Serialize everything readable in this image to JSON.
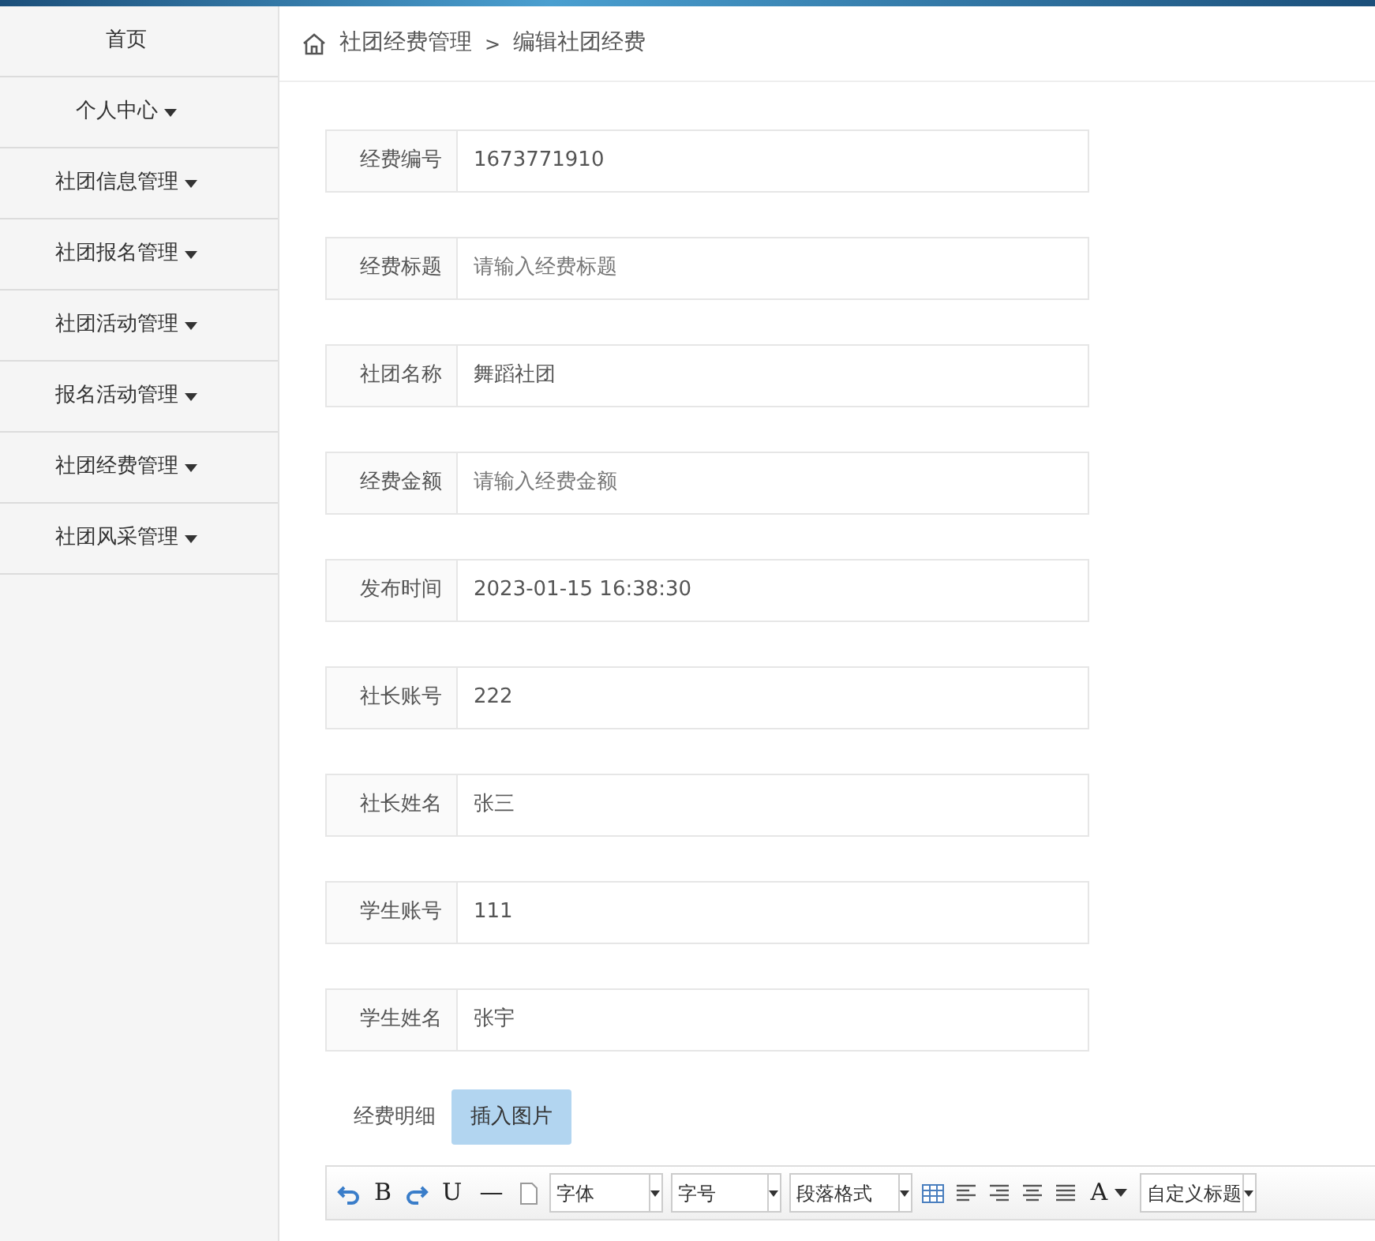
{
  "sidebar": {
    "items": [
      {
        "label": "首页",
        "dropdown": false
      },
      {
        "label": "个人中心",
        "dropdown": true
      },
      {
        "label": "社团信息管理",
        "dropdown": true
      },
      {
        "label": "社团报名管理",
        "dropdown": true
      },
      {
        "label": "社团活动管理",
        "dropdown": true
      },
      {
        "label": "报名活动管理",
        "dropdown": true
      },
      {
        "label": "社团经费管理",
        "dropdown": true
      },
      {
        "label": "社团风采管理",
        "dropdown": true
      }
    ]
  },
  "breadcrumb": {
    "items": [
      "社团经费管理",
      "编辑社团经费"
    ],
    "separator": ">"
  },
  "form": {
    "fields": [
      {
        "label": "经费编号",
        "value": "1673771910"
      },
      {
        "label": "经费标题",
        "placeholder": "请输入经费标题"
      },
      {
        "label": "社团名称",
        "value": "舞蹈社团"
      },
      {
        "label": "经费金额",
        "placeholder": "请输入经费金额"
      },
      {
        "label": "发布时间",
        "value": "2023-01-15 16:38:30"
      },
      {
        "label": "社长账号",
        "value": "222"
      },
      {
        "label": "社长姓名",
        "value": "张三"
      },
      {
        "label": "学生账号",
        "value": "111"
      },
      {
        "label": "学生姓名",
        "value": "张宇"
      }
    ],
    "detail_label": "经费明细",
    "insert_image_button": "插入图片"
  },
  "editor": {
    "toolbar": [
      {
        "kind": "undo"
      },
      {
        "kind": "glyph",
        "text": "B"
      },
      {
        "kind": "redo"
      },
      {
        "kind": "glyph",
        "text": "U"
      },
      {
        "kind": "glyph",
        "text": "—"
      },
      {
        "kind": "page"
      },
      {
        "kind": "select",
        "text": "字体"
      },
      {
        "kind": "select",
        "text": "字号"
      },
      {
        "kind": "select",
        "text": "段落格式"
      },
      {
        "kind": "table"
      },
      {
        "kind": "align-left"
      },
      {
        "kind": "align-right"
      },
      {
        "kind": "align-center"
      },
      {
        "kind": "justify"
      },
      {
        "kind": "color",
        "text": "A"
      },
      {
        "kind": "select",
        "text": "自定义标题"
      }
    ]
  }
}
